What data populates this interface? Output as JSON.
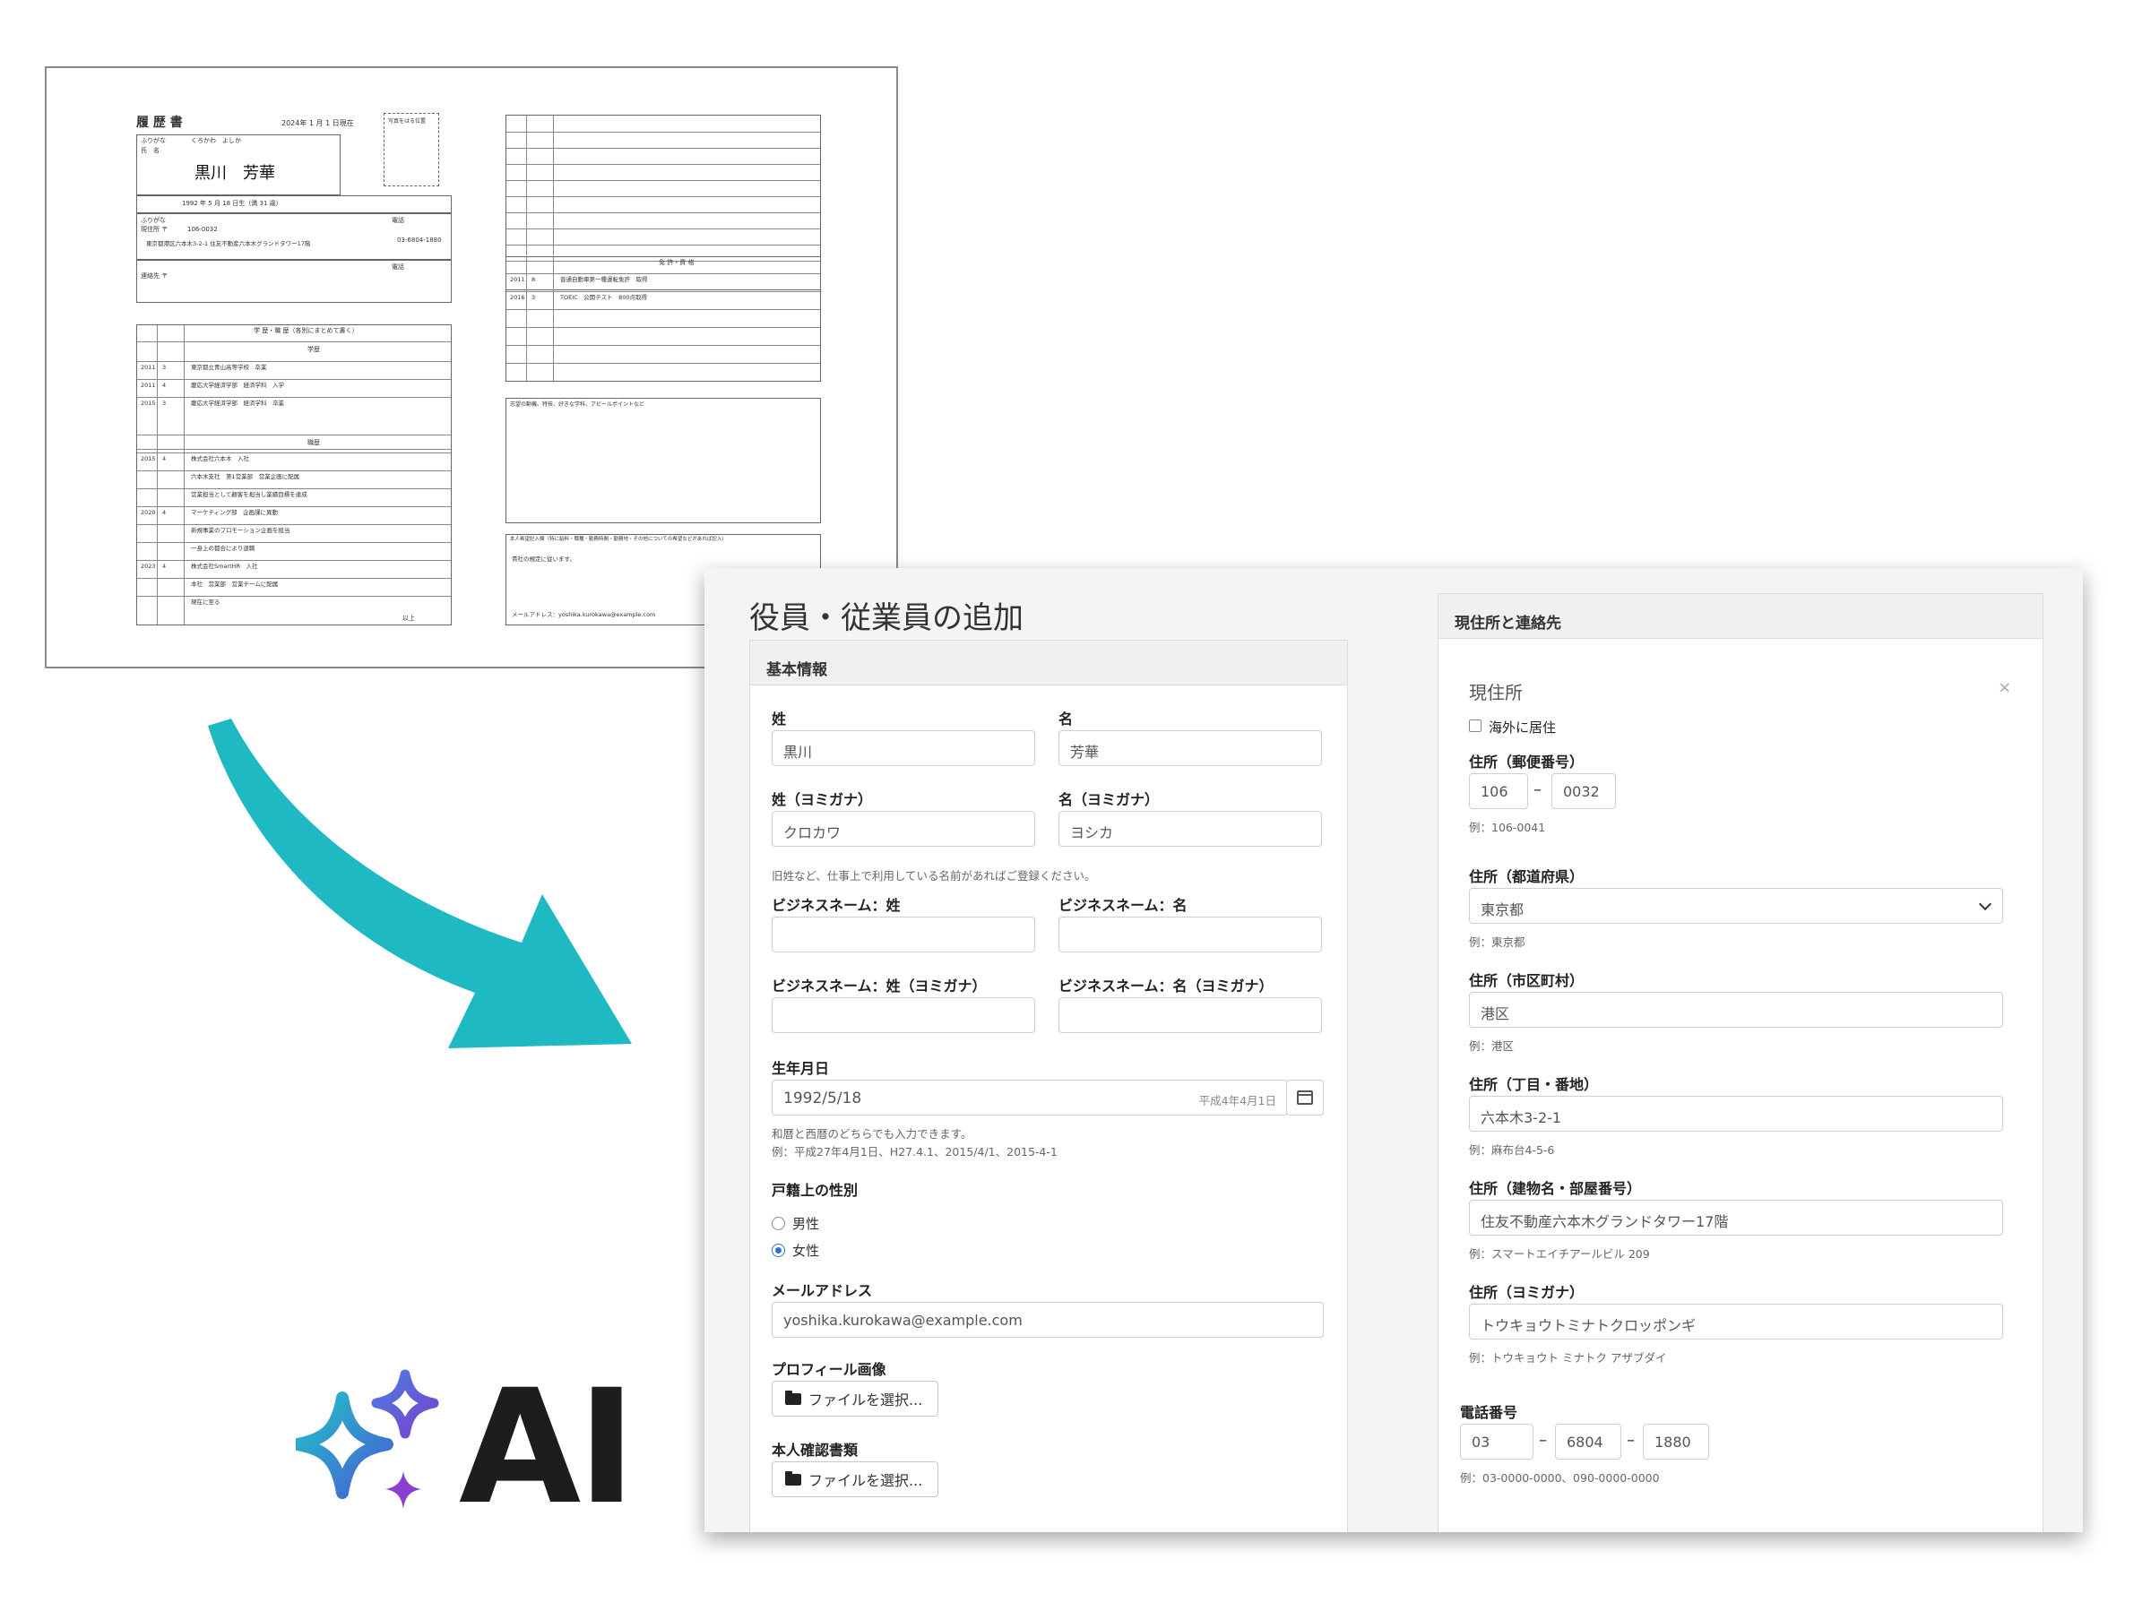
{
  "resume": {
    "title": "履 歴 書",
    "date": "2024年 1 月 1 日現在",
    "photo_note": "写真をはる位置",
    "furigana_label": "ふりがな",
    "furigana_name": "くろかわ　よしか",
    "name_label": "氏　名",
    "name": "黒川　芳華",
    "birth": "1992 年 5 月 18 日生（満 31 歳）",
    "address_label": "現住所 〒",
    "postal": "106-0032",
    "address": "東京都港区六本木3-2-1 住友不動産六本木グランドタワー17階",
    "phone_label": "電話",
    "phone": "03-6804-1880",
    "contact_label": "連絡先 〒",
    "history_header": "学 歴・職 歴（各別にまとめて書く）",
    "edu_label": "学歴",
    "work_label": "職歴",
    "history_rows": [
      [
        "2011",
        "3",
        "東京都立青山高等学校　卒業"
      ],
      [
        "2011",
        "4",
        "慶応大学経済学部　経済学科　入学"
      ],
      [
        "2015",
        "3",
        "慶応大学経済学部　経済学科　卒業"
      ],
      [
        "2015",
        "4",
        "株式会社六本木　入社"
      ],
      [
        "",
        "",
        "六本木支社　第1営業部　営業企画に配属"
      ],
      [
        "",
        "",
        "営業担当として顧客を担当し業績目標を達成"
      ],
      [
        "2020",
        "4",
        "マーケティング部　企画課に異動"
      ],
      [
        "",
        "",
        "新規事業のプロモーション企画を担当"
      ],
      [
        "",
        "",
        "一身上の都合により退職"
      ],
      [
        "2023",
        "4",
        "株式会社SmartHR　入社"
      ],
      [
        "",
        "",
        "本社　営業部　営業チームに配属"
      ],
      [
        "",
        "",
        "現在に至る"
      ]
    ],
    "end_label": "以上",
    "license_header": "免 許・資 格",
    "license_rows": [
      [
        "2011",
        "8",
        "普通自動車第一種運転免許　取得"
      ],
      [
        "2016",
        "3",
        "TOEIC　公開テスト　800点取得"
      ]
    ],
    "motivation_label": "志望の動機、特技、好きな学科、アピールポイントなど",
    "request_label": "本人希望記入欄（特に給料・職種・勤務時間・勤務地・その他についての希望などがあれば記入）",
    "request_text": "貴社の規定に従います。",
    "email_line": "メールアドレス：yoshika.kurokawa@example.com"
  },
  "ai_logo": {
    "text": "AI"
  },
  "colors": {
    "arrow": "#1fb9c4",
    "radio_on": "#2f6fdc"
  },
  "form": {
    "title": "役員・従業員の追加",
    "basic": {
      "header": "基本情報",
      "last_name_label": "姓",
      "last_name_value": "黒川",
      "first_name_label": "名",
      "first_name_value": "芳華",
      "last_kana_label": "姓（ヨミガナ）",
      "last_kana_value": "クロカワ",
      "first_kana_label": "名（ヨミガナ）",
      "first_kana_value": "ヨシカ",
      "business_hint": "旧姓など、仕事上で利用している名前があればご登録ください。",
      "biz_last_label": "ビジネスネーム：姓",
      "biz_first_label": "ビジネスネーム：名",
      "biz_last_kana_label": "ビジネスネーム：姓（ヨミガナ）",
      "biz_first_kana_label": "ビジネスネーム：名（ヨミガナ）",
      "birth_label": "生年月日",
      "birth_value": "1992/5/18",
      "birth_wareki": "平成4年4月1日",
      "birth_hint1": "和暦と西暦のどちらでも入力できます。",
      "birth_hint2": "例：平成27年4月1日、H27.4.1、2015/4/1、2015-4-1",
      "sex_label": "戸籍上の性別",
      "sex_male": "男性",
      "sex_female": "女性",
      "email_label": "メールアドレス",
      "email_value": "yoshika.kurokawa@example.com",
      "profile_label": "プロフィール画像",
      "file_button": "ファイルを選択...",
      "id_doc_label": "本人確認書類"
    },
    "address": {
      "header": "現住所と連絡先",
      "section_title": "現住所",
      "close": "×",
      "abroad_label": "海外に居住",
      "postal_label": "住所（郵便番号）",
      "postal1": "106",
      "postal2": "0032",
      "postal_hint": "例：106-0041",
      "pref_label": "住所（都道府県）",
      "pref_value": "東京都",
      "pref_hint": "例：東京都",
      "city_label": "住所（市区町村）",
      "city_value": "港区",
      "city_hint": "例：港区",
      "street_label": "住所（丁目・番地）",
      "street_value": "六本木3-2-1",
      "street_hint": "例：麻布台4-5-6",
      "building_label": "住所（建物名・部屋番号）",
      "building_value": "住友不動産六本木グランドタワー17階",
      "building_hint": "例：スマートエイチアールビル 209",
      "kana_label": "住所（ヨミガナ）",
      "kana_value": "トウキョウトミナトクロッポンギ",
      "kana_hint": "例：トウキョウト ミナトク アザブダイ",
      "phone_label": "電話番号",
      "phone1": "03",
      "phone2": "6804",
      "phone3": "1880",
      "phone_hint": "例：03-0000-0000、090-0000-0000"
    }
  }
}
